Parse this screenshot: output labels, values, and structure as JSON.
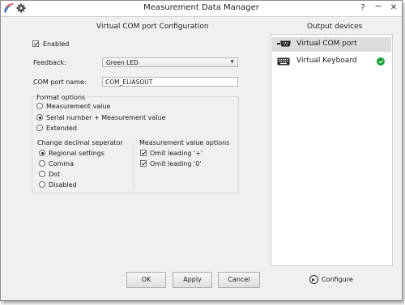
{
  "window": {
    "title": "Measurement Data Manager",
    "help": "?",
    "minimize": "−",
    "close": "✕"
  },
  "config": {
    "heading": "Virtual COM port Configuration",
    "enabled_label": "Enabled",
    "enabled_checked": true,
    "feedback_label": "Feedback:",
    "feedback_value": "Green LED",
    "com_label": "COM port name:",
    "com_value": "COM_ELIASOUT",
    "format": {
      "title": "Format options",
      "options": [
        "Measurement value",
        "Serial number + Measurement value",
        "Extended"
      ],
      "selected": 1
    },
    "decimal": {
      "title": "Change decimal seperator",
      "options": [
        "Regional settings",
        "Comma",
        "Dot",
        "Disabled"
      ],
      "selected": 0
    },
    "value_options": {
      "title": "Measurement value options",
      "items": [
        {
          "label": "Omit leading '+'",
          "checked": true
        },
        {
          "label": "Omit leading '0'",
          "checked": true
        }
      ]
    }
  },
  "buttons": {
    "ok": "OK",
    "apply": "Apply",
    "cancel": "Cancel"
  },
  "devices": {
    "heading": "Output devices",
    "items": [
      {
        "label": "Virtual COM port",
        "icon": "com-port-icon",
        "selected": true,
        "status": ""
      },
      {
        "label": "Virtual Keyboard",
        "icon": "keyboard-icon",
        "selected": false,
        "status": "ok"
      }
    ],
    "configure": "Configure"
  }
}
